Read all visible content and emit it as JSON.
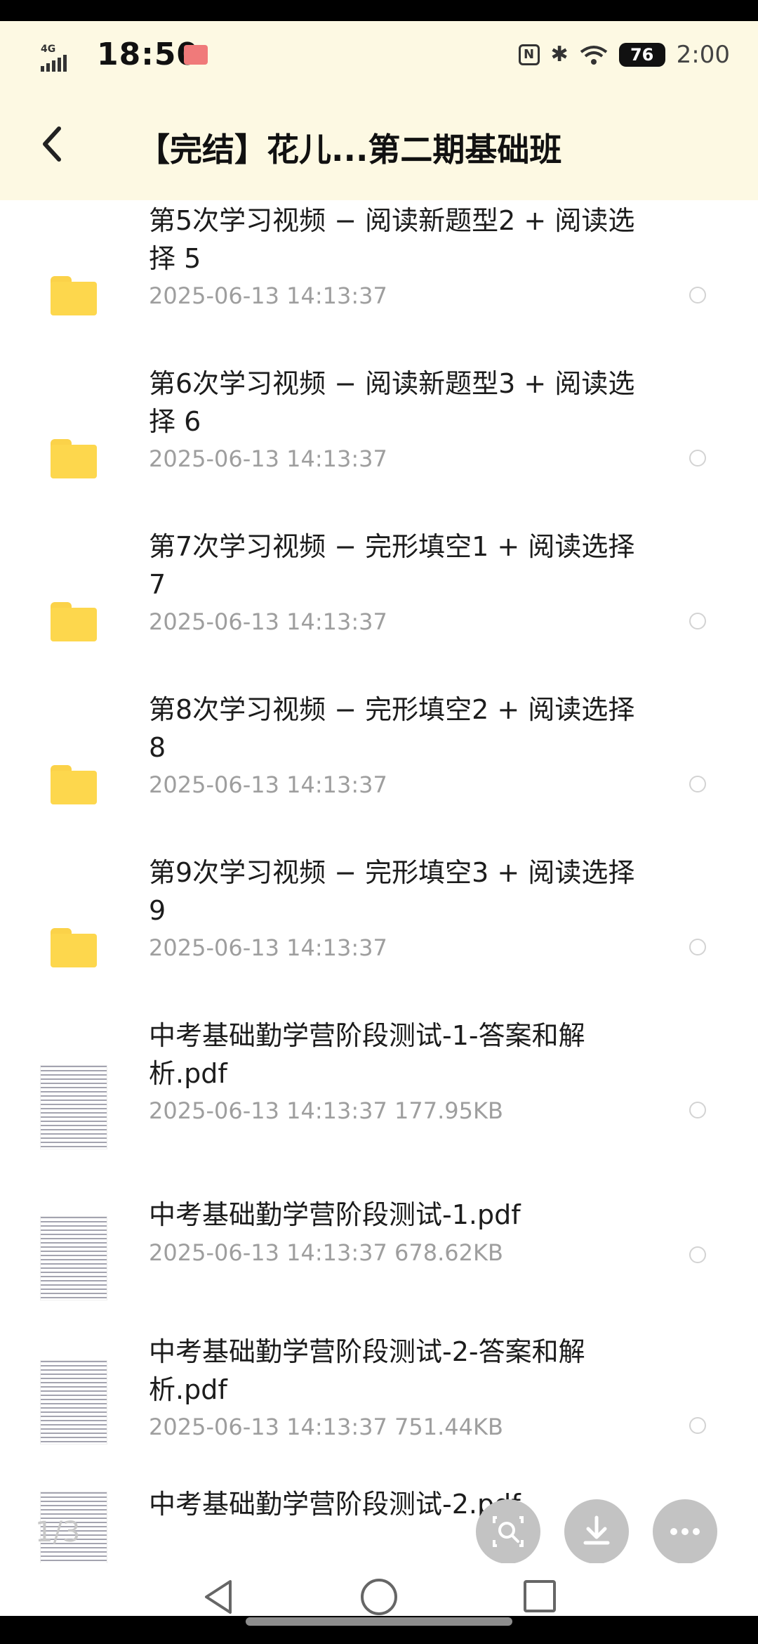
{
  "status_bar": {
    "network": "4G",
    "time": "18:50",
    "battery": "76",
    "clock_right": "2:00"
  },
  "header": {
    "back_icon": "chevron-left-icon",
    "title": "【完结】花儿...第二期基础班"
  },
  "items": [
    {
      "type": "folder",
      "name": "第5次学习视频 − 阅读新题型2 + 阅读选择 5",
      "meta": "2025-06-13  14:13:37"
    },
    {
      "type": "folder",
      "name": "第6次学习视频 − 阅读新题型3 + 阅读选择 6",
      "meta": "2025-06-13  14:13:37"
    },
    {
      "type": "folder",
      "name": "第7次学习视频 − 完形填空1 + 阅读选择 7",
      "meta": "2025-06-13  14:13:37"
    },
    {
      "type": "folder",
      "name": "第8次学习视频 − 完形填空2 + 阅读选择 8",
      "meta": "2025-06-13  14:13:37"
    },
    {
      "type": "folder",
      "name": "第9次学习视频 − 完形填空3 + 阅读选择 9",
      "meta": "2025-06-13  14:13:37"
    },
    {
      "type": "pdf",
      "name": "中考基础勤学营阶段测试-1-答案和解析.pdf",
      "meta": "2025-06-13  14:13:37   177.95KB"
    },
    {
      "type": "pdf",
      "name": "中考基础勤学营阶段测试-1.pdf",
      "meta": "2025-06-13  14:13:37   678.62KB"
    },
    {
      "type": "pdf",
      "name": "中考基础勤学营阶段测试-2-答案和解析.pdf",
      "meta": "2025-06-13  14:13:37   751.44KB"
    },
    {
      "type": "pdf",
      "name": "中考基础勤学营阶段测试-2.pdf",
      "meta": ""
    }
  ],
  "page_indicator": "1/3",
  "fabs": {
    "search_icon": "search-document-icon",
    "download_icon": "download-icon",
    "more_icon": "more-icon"
  },
  "colors": {
    "header_bg": "#fdf9e3",
    "folder": "#fdd74d",
    "meta_text": "#9e9e9e"
  }
}
